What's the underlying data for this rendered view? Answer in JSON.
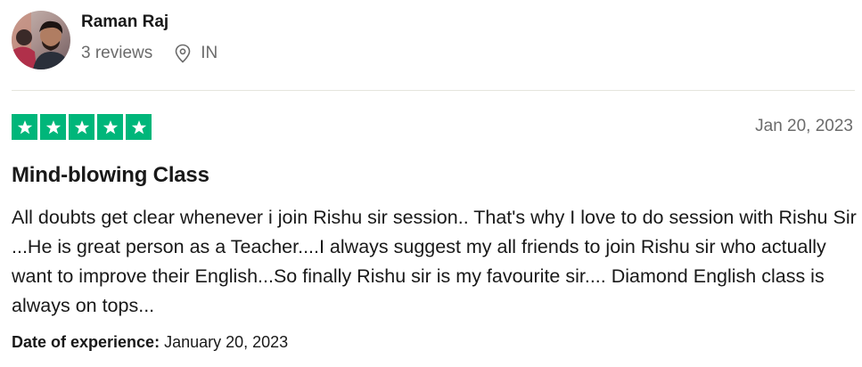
{
  "reviewer": {
    "name": "Raman Raj",
    "review_count": "3 reviews",
    "country": "IN",
    "avatar_icon": "user-photo-avatar"
  },
  "review": {
    "rating": 5,
    "rating_max": 5,
    "star_color": "#00b67a",
    "date": "Jan 20, 2023",
    "title": "Mind-blowing Class",
    "body": "All doubts get clear whenever i join Rishu sir session.. That's why I love to do session with Rishu Sir ...He is great person as a Teacher....I always suggest my all friends to join Rishu sir who actually want to improve their English...So finally Rishu sir is my favourite sir.... Diamond English class is always on tops...",
    "experience_label": "Date of experience:",
    "experience_date": "January 20, 2023"
  }
}
